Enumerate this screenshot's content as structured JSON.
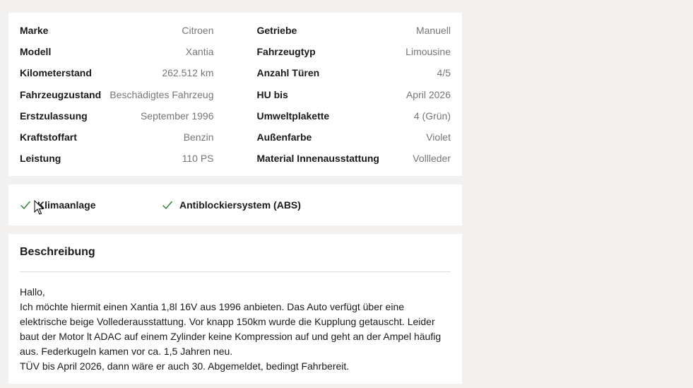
{
  "details": {
    "left": [
      {
        "label": "Marke",
        "value": "Citroen"
      },
      {
        "label": "Modell",
        "value": "Xantia"
      },
      {
        "label": "Kilometerstand",
        "value": "262.512 km"
      },
      {
        "label": "Fahrzeugzustand",
        "value": "Beschädigtes Fahrzeug"
      },
      {
        "label": "Erstzulassung",
        "value": "September 1996"
      },
      {
        "label": "Kraftstoffart",
        "value": "Benzin"
      },
      {
        "label": "Leistung",
        "value": "110 PS"
      }
    ],
    "right": [
      {
        "label": "Getriebe",
        "value": "Manuell"
      },
      {
        "label": "Fahrzeugtyp",
        "value": "Limousine"
      },
      {
        "label": "Anzahl Türen",
        "value": "4/5"
      },
      {
        "label": "HU bis",
        "value": "April 2026"
      },
      {
        "label": "Umweltplakette",
        "value": "4 (Grün)"
      },
      {
        "label": "Außenfarbe",
        "value": "Violet"
      },
      {
        "label": "Material Innenausstattung",
        "value": "Vollleder"
      }
    ]
  },
  "features": [
    {
      "label": "Klimaanlage",
      "icon": "check-icon"
    },
    {
      "label": "Antiblockiersystem (ABS)",
      "icon": "check-icon"
    }
  ],
  "colors": {
    "check": "#2e7d32",
    "label_gray": "#767676"
  },
  "description": {
    "title": "Beschreibung",
    "text": "Hallo,\nIch möchte hiermit einen Xantia 1,8l 16V aus 1996 anbieten. Das Auto verfügt über eine elektrische beige Vollederausstattung. Vor knapp 150km wurde die Kupplung getauscht. Leider baut der Motor lt ADAC auf einem Zylinder keine Kompression auf und geht an der Ampel häufig aus. Federkugeln kamen vor ca. 1,5 Jahren neu.\nTÜV bis April 2026, dann wäre er auch 30. Abgemeldet, bedingt Fahrbereit."
  }
}
